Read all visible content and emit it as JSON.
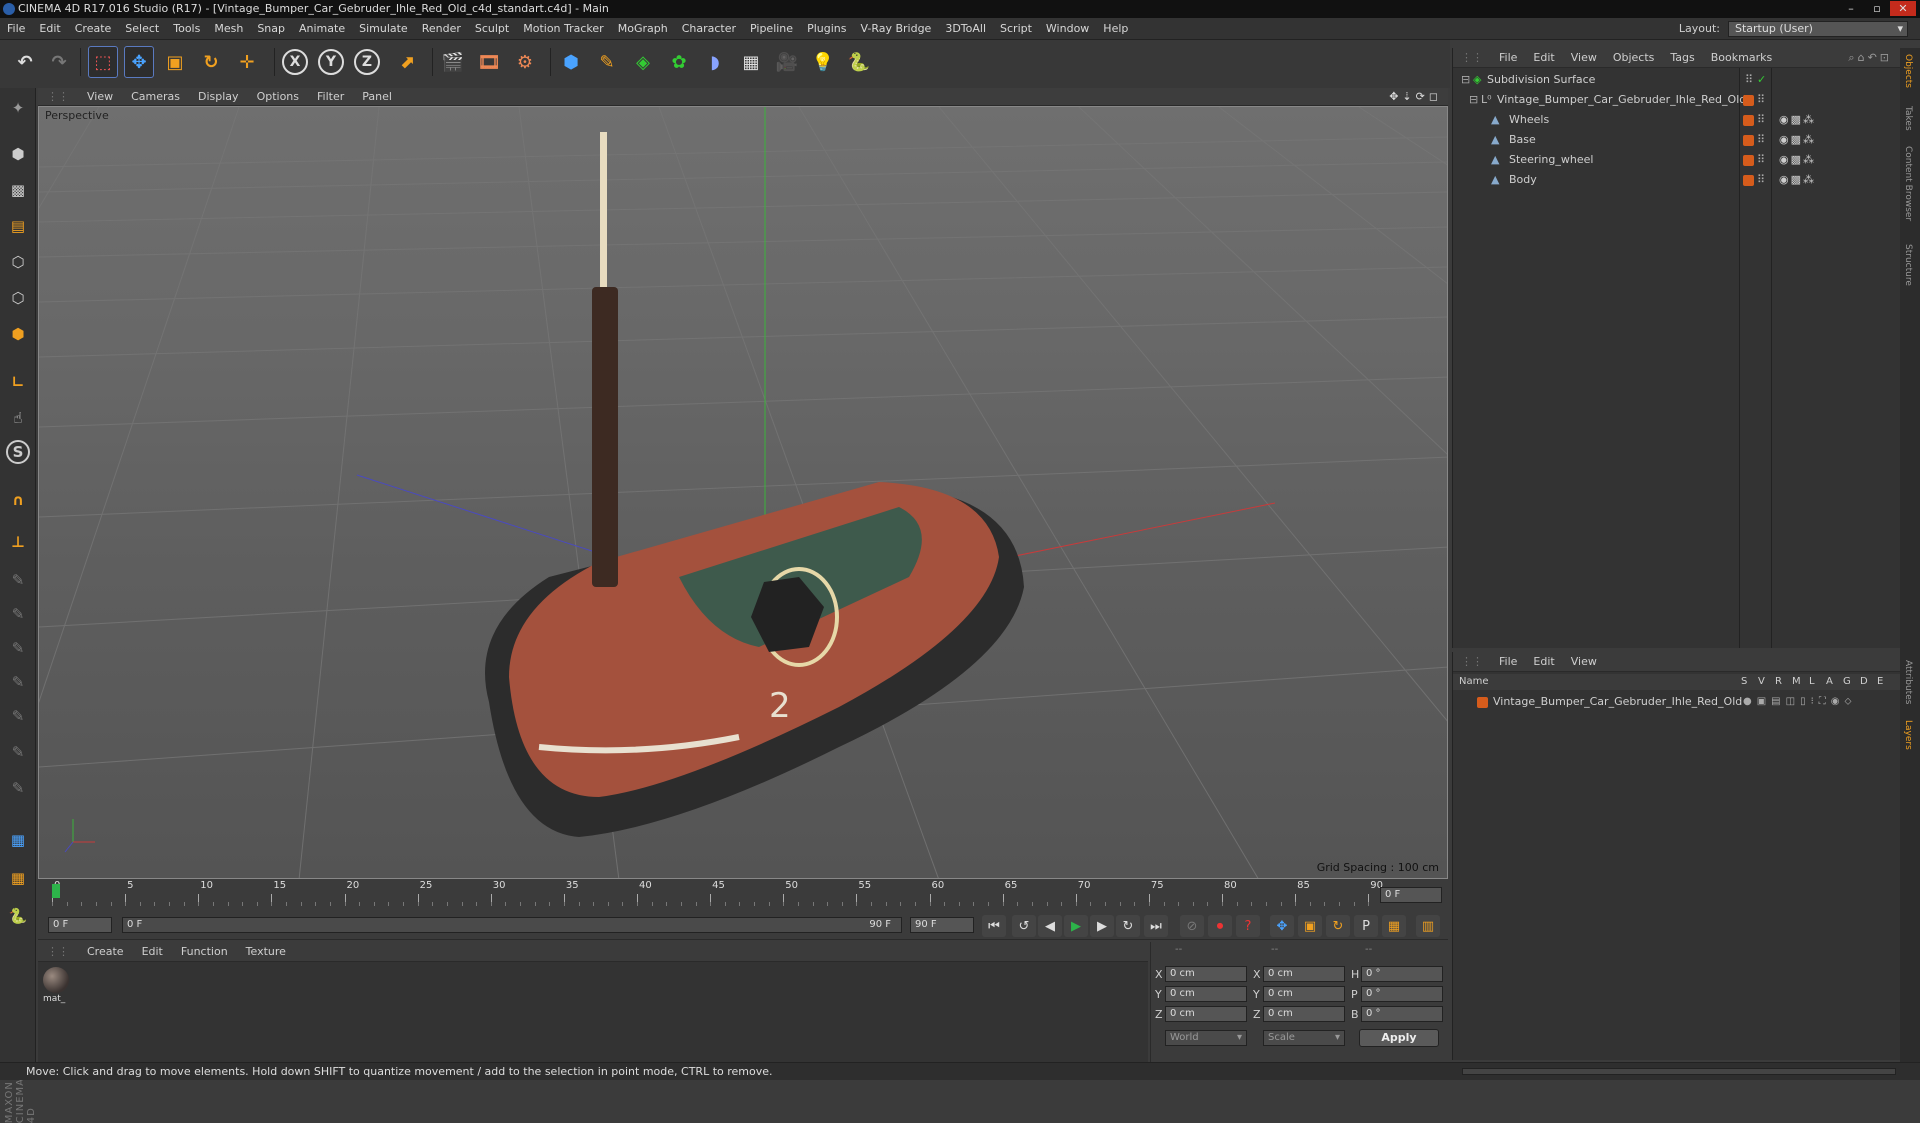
{
  "window": {
    "title": "CINEMA 4D R17.016 Studio (R17) - [Vintage_Bumper_Car_Gebruder_Ihle_Red_Old_c4d_standart.c4d] - Main"
  },
  "menubar": {
    "items": [
      "File",
      "Edit",
      "Create",
      "Select",
      "Tools",
      "Mesh",
      "Snap",
      "Animate",
      "Simulate",
      "Render",
      "Sculpt",
      "Motion Tracker",
      "MoGraph",
      "Character",
      "Pipeline",
      "Plugins",
      "V-Ray Bridge",
      "3DToAll",
      "Script",
      "Window",
      "Help"
    ],
    "layout_label": "Layout:",
    "layout_value": "Startup (User)"
  },
  "toolbar": {
    "axis_x": "X",
    "axis_y": "Y",
    "axis_z": "Z"
  },
  "viewport": {
    "menu": [
      "View",
      "Cameras",
      "Display",
      "Options",
      "Filter",
      "Panel"
    ],
    "label": "Perspective",
    "grid_spacing": "Grid Spacing : 100 cm",
    "car_number": "2"
  },
  "timeline": {
    "ticks": [
      "0",
      "5",
      "10",
      "15",
      "20",
      "25",
      "30",
      "35",
      "40",
      "45",
      "50",
      "55",
      "60",
      "65",
      "70",
      "75",
      "80",
      "85",
      "90"
    ],
    "current_frame": "0 F",
    "start_field": "0 F",
    "range_start": "0 F",
    "range_end": "90 F",
    "end_field": "90 F"
  },
  "material_manager": {
    "menu": [
      "Create",
      "Edit",
      "Function",
      "Texture"
    ],
    "material_name": "mat_"
  },
  "coordinates": {
    "header": [
      "--",
      "--",
      "--"
    ],
    "rows": [
      {
        "a": "X",
        "av": "0 cm",
        "b": "X",
        "bv": "0 cm",
        "c": "H",
        "cv": "0 °"
      },
      {
        "a": "Y",
        "av": "0 cm",
        "b": "Y",
        "bv": "0 cm",
        "c": "P",
        "cv": "0 °"
      },
      {
        "a": "Z",
        "av": "0 cm",
        "b": "Z",
        "bv": "0 cm",
        "c": "B",
        "cv": "0 °"
      }
    ],
    "mode_world": "World",
    "mode_scale": "Scale",
    "apply": "Apply"
  },
  "object_manager": {
    "menu": [
      "File",
      "Edit",
      "View",
      "Objects",
      "Tags",
      "Bookmarks"
    ],
    "objects": [
      {
        "name": "Subdivision Surface"
      },
      {
        "name": "Vintage_Bumper_Car_Gebruder_Ihle_Red_Old"
      },
      {
        "name": "Wheels"
      },
      {
        "name": "Base"
      },
      {
        "name": "Steering_wheel"
      },
      {
        "name": "Body"
      }
    ]
  },
  "layer_manager": {
    "menu": [
      "File",
      "Edit",
      "View"
    ],
    "columns": [
      "Name",
      "S",
      "V",
      "R",
      "M",
      "L",
      "A",
      "G",
      "D",
      "E"
    ],
    "layers": [
      {
        "name": "Vintage_Bumper_Car_Gebruder_Ihle_Red_Old"
      }
    ]
  },
  "right_tabs": [
    "Objects",
    "Takes",
    "Content Browser",
    "Structure",
    "Attributes",
    "Layers"
  ],
  "status": {
    "text": "Move: Click and drag to move elements. Hold down SHIFT to quantize movement / add to the selection in point mode, CTRL to remove."
  },
  "brand": "MAXON CINEMA 4D",
  "colors": {
    "accent": "#5a7ac0",
    "layer_orange": "#d65c1c",
    "car_body": "#b0604a",
    "bumper": "#2c2c2c"
  }
}
